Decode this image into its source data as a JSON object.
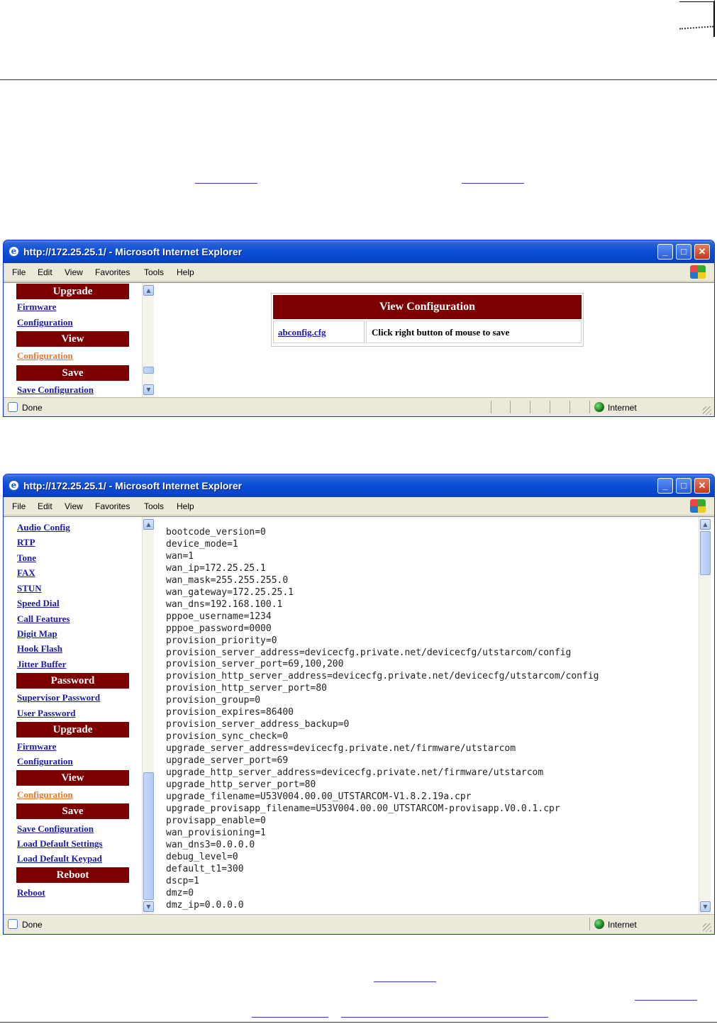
{
  "window1": {
    "title": "http://172.25.25.1/ - Microsoft Internet Explorer",
    "menu": [
      "File",
      "Edit",
      "View",
      "Favorites",
      "Tools",
      "Help"
    ],
    "nav": {
      "upgrade_heading": "Upgrade",
      "firmware": "Firmware",
      "configuration": "Configuration",
      "view_heading": "View",
      "view_configuration": "Configuration",
      "save_heading": "Save",
      "save_configuration": "Save Configuration"
    },
    "view_config": {
      "header": "View Configuration",
      "file_link": "abconfig.cfg",
      "note": "Click right button of mouse to save"
    },
    "status": {
      "text": "Done",
      "zone": "Internet"
    }
  },
  "window2": {
    "title": "http://172.25.25.1/ - Microsoft Internet Explorer",
    "menu": [
      "File",
      "Edit",
      "View",
      "Favorites",
      "Tools",
      "Help"
    ],
    "nav": {
      "audio_config": "Audio Config",
      "rtp": "RTP",
      "tone": "Tone",
      "fax": "FAX",
      "stun": "STUN",
      "speed_dial": "Speed Dial",
      "call_features": "Call Features",
      "digit_map": "Digit Map",
      "hook_flash": "Hook Flash",
      "jitter_buffer": "Jitter Buffer",
      "password_heading": "Password",
      "supervisor_password": "Supervisor Password",
      "user_password": "User Password",
      "upgrade_heading": "Upgrade",
      "firmware": "Firmware",
      "configuration": "Configuration",
      "view_heading": "View",
      "view_configuration": "Configuration",
      "save_heading": "Save",
      "save_configuration": "Save Configuration",
      "load_default_settings": "Load Default Settings",
      "load_default_keypad": "Load Default Keypad",
      "reboot_heading": "Reboot",
      "reboot": "Reboot"
    },
    "config_lines": [
      "bootcode_version=0",
      "device_mode=1",
      "wan=1",
      "wan_ip=172.25.25.1",
      "wan_mask=255.255.255.0",
      "wan_gateway=172.25.25.1",
      "wan_dns=192.168.100.1",
      "pppoe_username=1234",
      "pppoe_password=0000",
      "provision_priority=0",
      "provision_server_address=devicecfg.private.net/devicecfg/utstarcom/config",
      "provision_server_port=69,100,200",
      "provision_http_server_address=devicecfg.private.net/devicecfg/utstarcom/config",
      "provision_http_server_port=80",
      "provision_group=0",
      "provision_expires=86400",
      "provision_server_address_backup=0",
      "provision_sync_check=0",
      "upgrade_server_address=devicecfg.private.net/firmware/utstarcom",
      "upgrade_server_port=69",
      "upgrade_http_server_address=devicecfg.private.net/firmware/utstarcom",
      "upgrade_http_server_port=80",
      "upgrade_filename=U53V004.00.00_UTSTARCOM-V1.8.2.19a.cpr",
      "upgrade_provisapp_filename=U53V004.00.00_UTSTARCOM-provisapp.V0.0.1.cpr",
      "provisapp_enable=0",
      "wan_provisioning=1",
      "wan_dns3=0.0.0.0",
      "debug_level=0",
      "default_t1=300",
      "dscp=1",
      "dmz=0",
      "dmz_ip=0.0.0.0"
    ],
    "status": {
      "text": "Done",
      "zone": "Internet"
    }
  },
  "colors": {
    "nav_heading_bg": "#7c0000",
    "link": "#1a1aa8",
    "visited_link": "#e8772a",
    "titlebar": "#0a4ed6"
  }
}
